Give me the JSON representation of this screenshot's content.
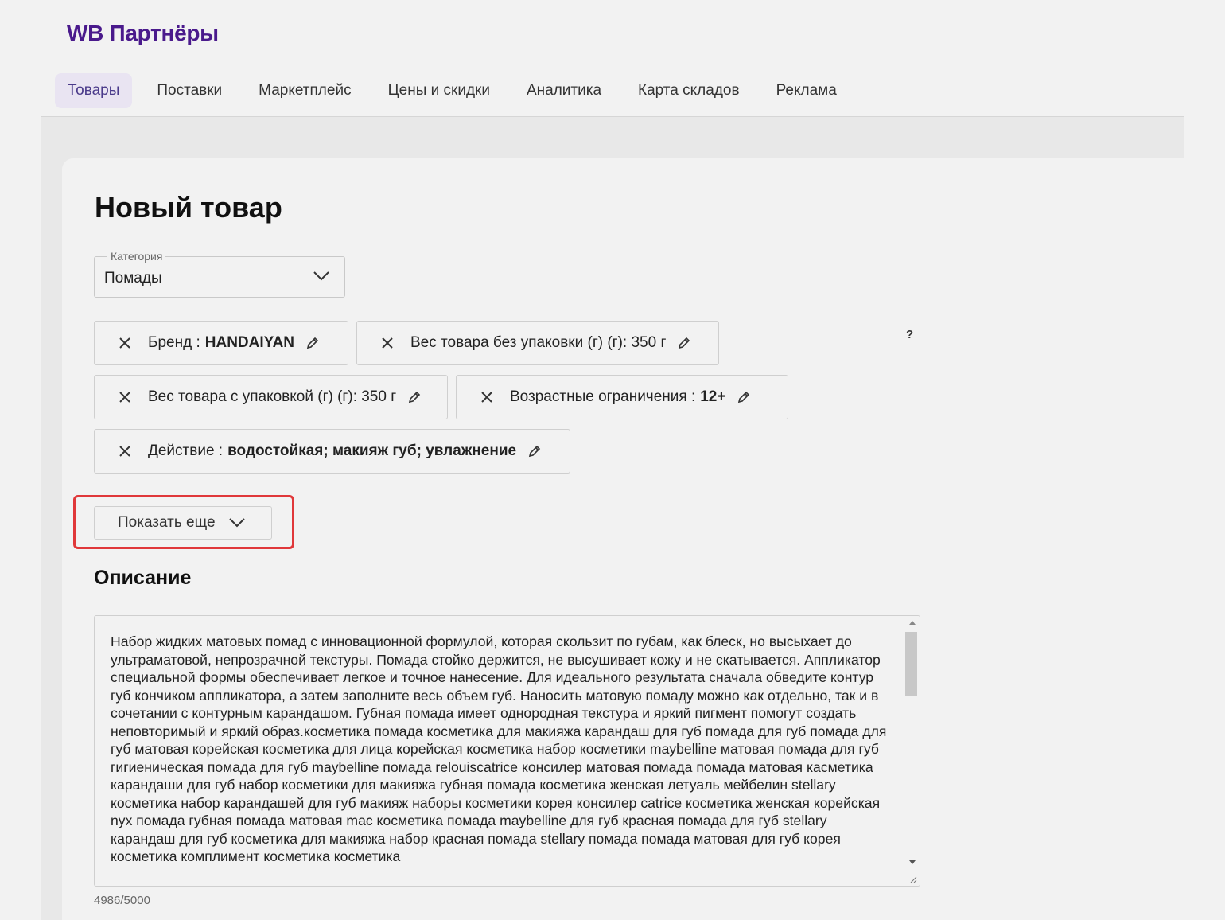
{
  "header": {
    "logo": "WB Партнёры"
  },
  "nav": [
    {
      "label": "Товары",
      "active": true
    },
    {
      "label": "Поставки"
    },
    {
      "label": "Маркетплейс"
    },
    {
      "label": "Цены и скидки"
    },
    {
      "label": "Аналитика"
    },
    {
      "label": "Карта складов"
    },
    {
      "label": "Реклама"
    }
  ],
  "page": {
    "title": "Новый товар"
  },
  "category": {
    "legend": "Категория",
    "value": "Помады"
  },
  "chips": [
    {
      "label": "Бренд :",
      "value": "HANDAIYAN"
    },
    {
      "label": "Вес товара без упаковки (г) (г): 350 г",
      "value": ""
    },
    {
      "label": "Вес товара с упаковкой (г) (г): 350 г",
      "value": ""
    },
    {
      "label": "Возрастные ограничения :",
      "value": "12+"
    },
    {
      "label": "Действие :",
      "value": "водостойкая; макияж губ; увлажнение"
    }
  ],
  "help": {
    "label": "?"
  },
  "show_more": {
    "label": "Показать еще"
  },
  "description": {
    "heading": "Описание",
    "text": "Набор жидких матовых помад с инновационной формулой, которая скользит по губам, как блеск, но высыхает до ультраматовой, непрозрачной текстуры. Помада стойко держится, не высушивает кожу и не скатывается. Аппликатор специальной формы обеспечивает легкое и точное нанесение. Для идеального результата сначала обведите контур губ кончиком аппликатора, а затем заполните весь объем губ. Наносить матовую помаду можно как отдельно, так и в сочетании с контурным карандашом. Губная помада имеет однородная текстура и яркий пигмент помогут создать неповторимый и яркий образ.косметика помада косметика для макияжа карандаш для губ помада для губ помада для губ матовая корейская косметика для лица корейская косметика набор косметики maybelline матовая помада для губ гигиеническая помада для губ maybelline помада relouiscatrice консилер матовая помада помада матовая касметика карандаши для губ набор косметики для макияжа губная помада косметика женская летуаль мейбелин stellary косметика набор карандашей для губ макияж наборы косметики корея консилер catrice косметика женская корейская nyx помада губная помада матовая mac косметика помада maybelline для губ красная помада для губ stellary карандаш для губ косметика для макияжа набор красная помада stellary помада помада матовая для губ корея косметика комплимент косметика косметика",
    "counter": "4986/5000"
  }
}
